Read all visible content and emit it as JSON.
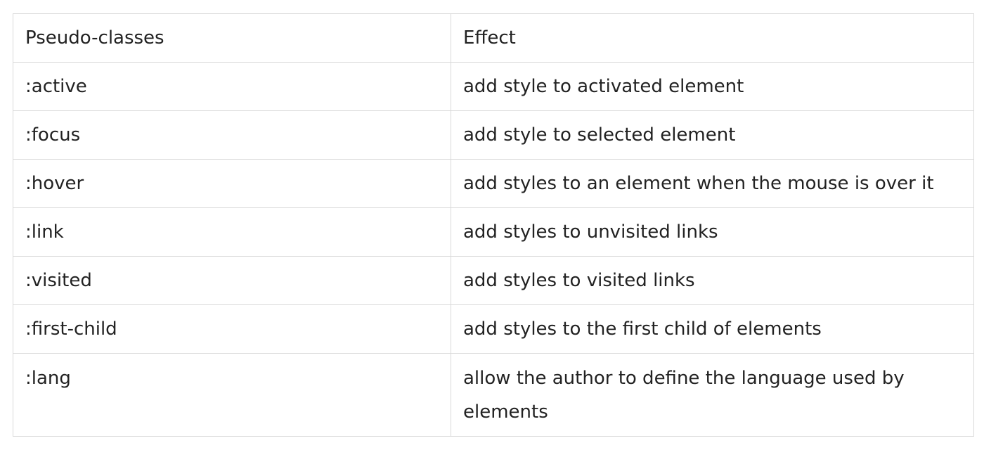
{
  "table": {
    "headers": [
      "Pseudo-classes",
      "Effect"
    ],
    "rows": [
      [
        ":active",
        "add style to activated element"
      ],
      [
        ":focus",
        "add style to selected element"
      ],
      [
        ":hover",
        "add styles to an element when the mouse is over it"
      ],
      [
        ":link",
        "add styles to unvisited links"
      ],
      [
        ":visited",
        "add styles to visited links"
      ],
      [
        ":first-child",
        "add styles to the first child of elements"
      ],
      [
        ":lang",
        "allow the author to define the language used by elements"
      ]
    ]
  },
  "colors": {
    "border": "#d9d9d9",
    "text": "#222222",
    "background": "#ffffff"
  }
}
